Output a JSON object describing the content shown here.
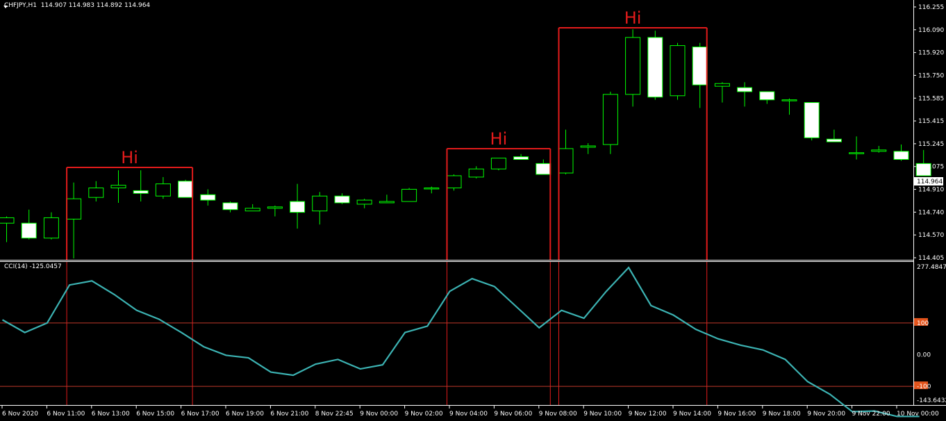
{
  "header": {
    "symbol": "CHFJPY,H1",
    "ohlc": "114.907 114.983 114.892 114.964"
  },
  "indicator": {
    "label": "CCI(14) -125.0457",
    "levels": [
      "100",
      "0.00",
      "-100"
    ],
    "max_label": "277.4847",
    "min_label": "-143.6432"
  },
  "price_axis": {
    "ticks": [
      "116.255",
      "116.090",
      "115.920",
      "115.750",
      "115.585",
      "115.415",
      "115.245",
      "115.075",
      "114.910",
      "114.740",
      "114.570",
      "114.405"
    ],
    "current_price": "114.964"
  },
  "time_axis": {
    "ticks": [
      "6 Nov 2020",
      "6 Nov 11:00",
      "6 Nov 13:00",
      "6 Nov 15:00",
      "6 Nov 17:00",
      "6 Nov 19:00",
      "6 Nov 21:00",
      "8 Nov 22:45",
      "9 Nov 00:00",
      "9 Nov 02:00",
      "9 Nov 04:00",
      "9 Nov 06:00",
      "9 Nov 08:00",
      "9 Nov 10:00",
      "9 Nov 12:00",
      "9 Nov 14:00",
      "9 Nov 16:00",
      "9 Nov 18:00",
      "9 Nov 20:00",
      "9 Nov 22:00",
      "10 Nov 00:00"
    ]
  },
  "annotations": [
    {
      "label": "Hi",
      "from": 3,
      "to": 8
    },
    {
      "label": "Hi",
      "from": 20,
      "to": 24
    },
    {
      "label": "Hi",
      "from": 25,
      "to": 31
    }
  ],
  "colors": {
    "background": "#000000",
    "bull_body": "#000000",
    "bear_body": "#ffffff",
    "wick": "#00ff00",
    "cci_line": "#3cb3b3",
    "annotation": "#e31b1b",
    "level_line": "#c0392b",
    "grid": "#ffffff"
  },
  "chart_data": {
    "type": "candlestick",
    "ylim": [
      114.405,
      116.255
    ],
    "candles": [
      {
        "o": 114.66,
        "h": 114.71,
        "l": 114.52,
        "c": 114.7
      },
      {
        "o": 114.66,
        "h": 114.76,
        "l": 114.54,
        "c": 114.55
      },
      {
        "o": 114.55,
        "h": 114.74,
        "l": 114.54,
        "c": 114.7
      },
      {
        "o": 114.69,
        "h": 114.96,
        "l": 114.4,
        "c": 114.84
      },
      {
        "o": 114.85,
        "h": 114.97,
        "l": 114.82,
        "c": 114.92
      },
      {
        "o": 114.92,
        "h": 115.05,
        "l": 114.81,
        "c": 114.94
      },
      {
        "o": 114.9,
        "h": 115.05,
        "l": 114.82,
        "c": 114.88
      },
      {
        "o": 114.86,
        "h": 115.0,
        "l": 114.84,
        "c": 114.95
      },
      {
        "o": 114.97,
        "h": 114.98,
        "l": 114.85,
        "c": 114.85
      },
      {
        "o": 114.87,
        "h": 114.91,
        "l": 114.79,
        "c": 114.83
      },
      {
        "o": 114.81,
        "h": 114.82,
        "l": 114.74,
        "c": 114.76
      },
      {
        "o": 114.75,
        "h": 114.8,
        "l": 114.75,
        "c": 114.77
      },
      {
        "o": 114.77,
        "h": 114.79,
        "l": 114.71,
        "c": 114.78
      },
      {
        "o": 114.82,
        "h": 114.95,
        "l": 114.62,
        "c": 114.74
      },
      {
        "o": 114.75,
        "h": 114.89,
        "l": 114.65,
        "c": 114.86
      },
      {
        "o": 114.86,
        "h": 114.88,
        "l": 114.8,
        "c": 114.81
      },
      {
        "o": 114.8,
        "h": 114.84,
        "l": 114.77,
        "c": 114.83
      },
      {
        "o": 114.81,
        "h": 114.87,
        "l": 114.81,
        "c": 114.82
      },
      {
        "o": 114.82,
        "h": 114.92,
        "l": 114.82,
        "c": 114.91
      },
      {
        "o": 114.92,
        "h": 114.93,
        "l": 114.88,
        "c": 114.92
      },
      {
        "o": 114.92,
        "h": 115.02,
        "l": 114.9,
        "c": 115.01
      },
      {
        "o": 115.0,
        "h": 115.08,
        "l": 114.99,
        "c": 115.06
      },
      {
        "o": 115.06,
        "h": 115.14,
        "l": 115.05,
        "c": 115.14
      },
      {
        "o": 115.15,
        "h": 115.17,
        "l": 115.13,
        "c": 115.13
      },
      {
        "o": 115.1,
        "h": 115.13,
        "l": 115.02,
        "c": 115.02
      },
      {
        "o": 115.03,
        "h": 115.35,
        "l": 115.02,
        "c": 115.21
      },
      {
        "o": 115.22,
        "h": 115.25,
        "l": 115.17,
        "c": 115.23
      },
      {
        "o": 115.24,
        "h": 115.63,
        "l": 115.17,
        "c": 115.61
      },
      {
        "o": 115.61,
        "h": 116.09,
        "l": 115.52,
        "c": 116.03
      },
      {
        "o": 116.03,
        "h": 116.08,
        "l": 115.57,
        "c": 115.59
      },
      {
        "o": 115.6,
        "h": 115.99,
        "l": 115.57,
        "c": 115.97
      },
      {
        "o": 115.96,
        "h": 115.99,
        "l": 115.51,
        "c": 115.68
      },
      {
        "o": 115.67,
        "h": 115.7,
        "l": 115.55,
        "c": 115.69
      },
      {
        "o": 115.66,
        "h": 115.7,
        "l": 115.52,
        "c": 115.63
      },
      {
        "o": 115.63,
        "h": 115.63,
        "l": 115.54,
        "c": 115.57
      },
      {
        "o": 115.57,
        "h": 115.58,
        "l": 115.46,
        "c": 115.57
      },
      {
        "o": 115.55,
        "h": 115.55,
        "l": 115.27,
        "c": 115.29
      },
      {
        "o": 115.28,
        "h": 115.35,
        "l": 115.26,
        "c": 115.26
      },
      {
        "o": 115.18,
        "h": 115.3,
        "l": 115.13,
        "c": 115.18
      },
      {
        "o": 115.19,
        "h": 115.23,
        "l": 115.18,
        "c": 115.2
      },
      {
        "o": 115.19,
        "h": 115.24,
        "l": 115.12,
        "c": 115.13
      },
      {
        "o": 115.1,
        "h": 115.2,
        "l": 115.02,
        "c": 115.01
      }
    ],
    "cci": {
      "name": "CCI(14)",
      "ylim": [
        -143.6432,
        277.4847
      ],
      "values": [
        110,
        70,
        100,
        220,
        233,
        190,
        140,
        112,
        70,
        25,
        -2,
        -10,
        -55,
        -65,
        -30,
        -15,
        -45,
        -32,
        70,
        90,
        200,
        240,
        215,
        150,
        85,
        140,
        115,
        200,
        275,
        155,
        125,
        80,
        50,
        30,
        15,
        -15,
        -85,
        -125,
        -180,
        -178,
        -195,
        -195
      ]
    }
  }
}
